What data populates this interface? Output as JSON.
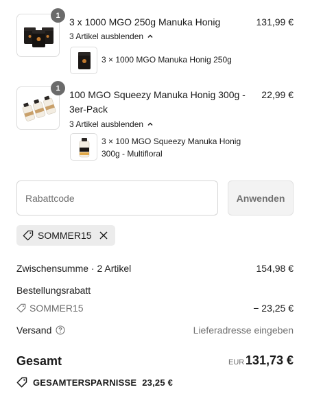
{
  "items": [
    {
      "quantity": "1",
      "title": "3 x 1000 MGO 250g Manuka Honig",
      "price": "131,99 €",
      "toggle_label": "3 Artikel ausblenden",
      "sub_label": "3 × 1000 MGO Manuka Honig 250g"
    },
    {
      "quantity": "1",
      "title": "100 MGO Squeezy Manuka Honig 300g - 3er-Pack",
      "price": "22,99 €",
      "toggle_label": "3 Artikel ausblenden",
      "sub_label": "3 × 100 MGO Squeezy Manuka Honig 300g - Multifloral"
    }
  ],
  "discount": {
    "placeholder": "Rabattcode",
    "apply_label": "Anwenden",
    "applied_code": "SOMMER15"
  },
  "summary": {
    "subtotal_label": "Zwischensumme · 2 Artikel",
    "subtotal_value": "154,98 €",
    "order_discount_label": "Bestellungsrabatt",
    "order_discount_code": "SOMMER15",
    "order_discount_value": "− 23,25 €",
    "shipping_label": "Versand",
    "shipping_value": "Lieferadresse eingeben",
    "total_label": "Gesamt",
    "total_currency": "EUR",
    "total_value": "131,73 €",
    "savings_label": "GESAMTERSPARNISSE",
    "savings_value": "23,25 €"
  }
}
